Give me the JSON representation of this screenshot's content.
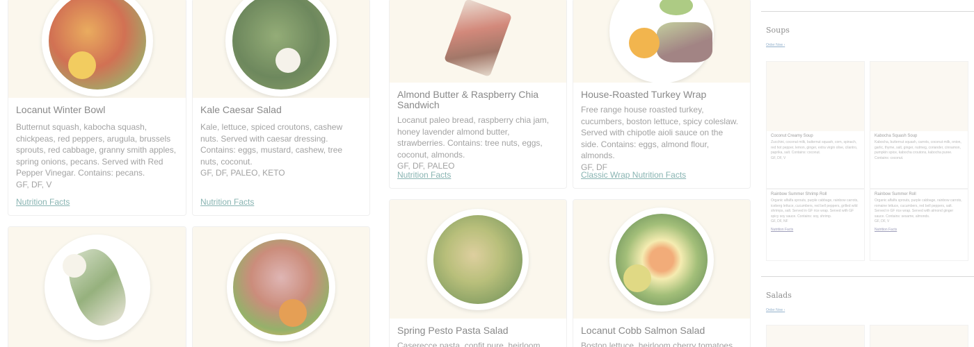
{
  "cards": [
    {
      "title": "Locanut Winter Bowl",
      "desc": "Butternut squash, kabocha squash, chickpeas, red peppers, arugula, brussels sprouts, red cabbage, granny smith apples, spring onions, pecans. Served with Red Pepper Vinegar. Contains: pecans.",
      "tags": "GF, DF, V",
      "link": "Nutrition Facts"
    },
    {
      "title": "Kale Caesar Salad",
      "desc": "Kale, lettuce, spiced croutons, cashew nuts. Served with caesar dressing. Contains: eggs, mustard, cashew, tree nuts, coconut.",
      "tags": "GF, DF, PALEO, KETO",
      "link": "Nutrition Facts"
    },
    {
      "title": "Almond Butter & Raspberry Chia Sandwich",
      "desc": "Locanut paleo bread, raspberry chia jam, honey lavender almond butter, strawberries. Contains: tree nuts, eggs, coconut, almonds.",
      "tags": "GF, DF, PALEO",
      "link": "Nutrition Facts"
    },
    {
      "title": "House-Roasted Turkey Wrap",
      "desc": "Free range house roasted turkey, cucumbers, boston lettuce, spicy coleslaw. Served with chipotle aioli sauce on the side. Contains: eggs, almond flour, almonds.",
      "tags": "GF, DF",
      "link": "Classic Wrap Nutrition Facts"
    },
    {
      "title": "Spring Pesto Pasta Salad",
      "desc": "Caserecce pasta, confit pure, heirloom"
    },
    {
      "title": "Locanut Cobb Salmon Salad",
      "desc": "Boston lettuce, heirloom cherry tomatoes,"
    }
  ],
  "side": {
    "soups_title": "Soups",
    "salads_title": "Salads",
    "order_now": "Order Now",
    "minis": [
      {
        "title": "Coconut Creamy Soup",
        "text": "Zucchini, coconut milk, butternut squash, corn, spinach, red hot pepper, lemon, ginger, extra virgin olive, cilantro, paprika, salt. Contains: coconut.",
        "tags": "GF, DF, V"
      },
      {
        "title": "Kabocha Squash Soup",
        "text": "Kabocha, butternut squash, carrots, coconut milk, onion, garlic, thyme, salt, ginger, nutmeg, coriander, cinnamon, pumpkin spice, kabocha croutons, kabocha puree. Contains: coconut.",
        "tags": ""
      },
      {
        "title": "Rainbow Summer Shrimp Roll",
        "text": "Organic alfalfa sprouts, purple cabbage, rainbow carrots, iceberg lettuce, cucumbers, red bell peppers, grilled wild shrimps, salt. Served in GF rice wrap. Served with GF spicy soy sauce. Contains: soy, shrimp.",
        "tags": "GF, DF, NF",
        "link": "Nutrition Facts"
      },
      {
        "title": "Rainbow Summer Roll",
        "text": "Organic alfalfa sprouts, purple cabbage, rainbow carrots, romaine lettuce, cucumbers, red bell peppers, salt. Served in GF rice wrap. Served with almond ginger sauce. Contains: sesame, almonds.",
        "tags": "GF, DF, V",
        "link": "Nutrition Facts"
      }
    ]
  },
  "colors": {
    "link": "#6fa4a2",
    "photo_bg": "#faf6ea"
  }
}
